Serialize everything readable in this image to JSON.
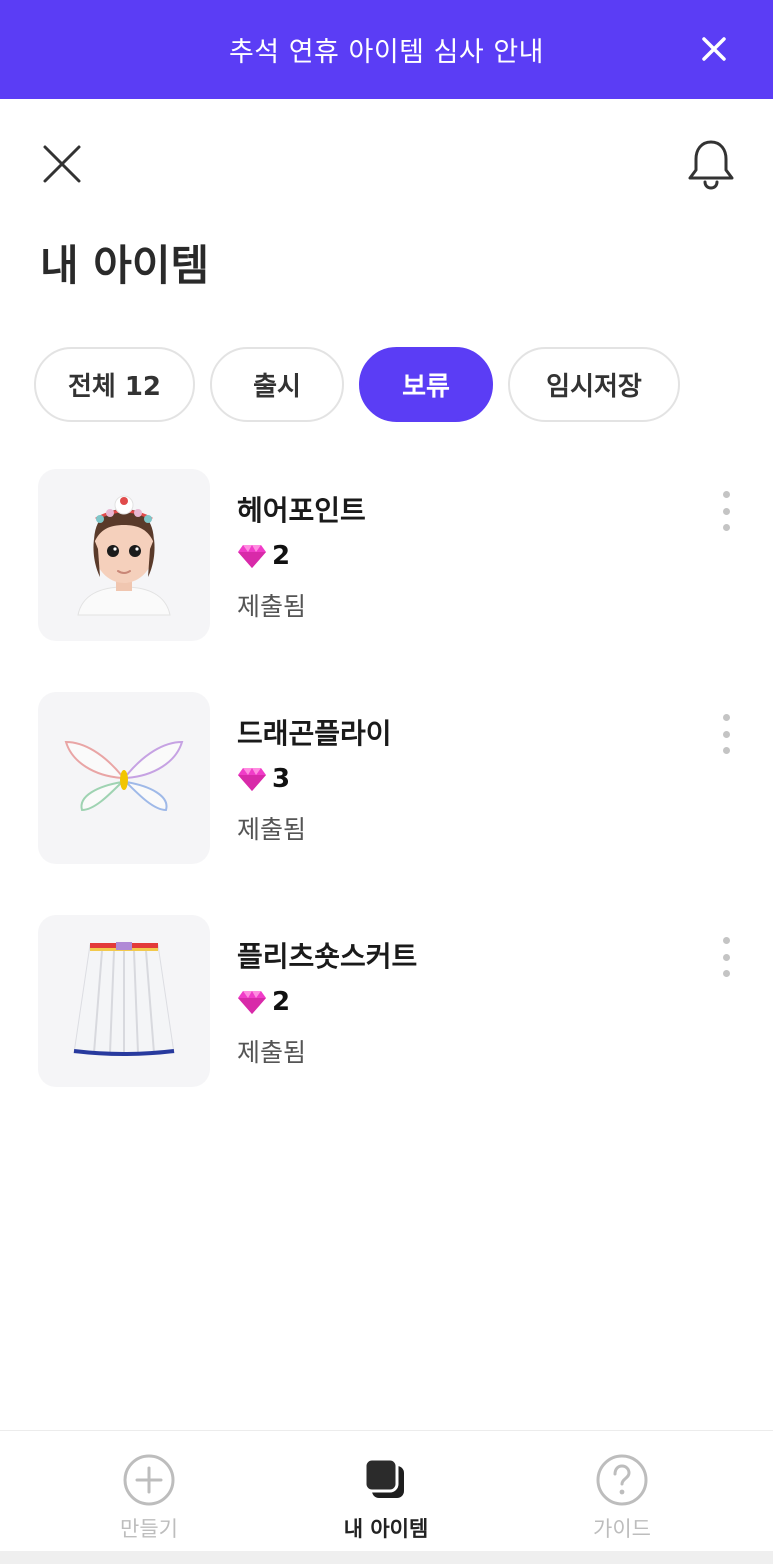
{
  "banner": {
    "text": "추석 연휴 아이템 심사 안내",
    "accent": "#5b3df5"
  },
  "header": {
    "title": "내 아이템"
  },
  "tabs": [
    {
      "label": "전체 12",
      "active": false
    },
    {
      "label": "출시",
      "active": false
    },
    {
      "label": "보류",
      "active": true
    },
    {
      "label": "임시저장",
      "active": false
    }
  ],
  "items": [
    {
      "name": "헤어포인트",
      "price": "2",
      "status": "제출됨",
      "thumb_icon": "avatar-hair-accessory"
    },
    {
      "name": "드래곤플라이",
      "price": "3",
      "status": "제출됨",
      "thumb_icon": "dragonfly-wings"
    },
    {
      "name": "플리츠숏스커트",
      "price": "2",
      "status": "제출됨",
      "thumb_icon": "pleated-skirt"
    }
  ],
  "bottom_nav": {
    "create": "만들기",
    "my_items": "내 아이템",
    "guide": "가이드",
    "active": "my_items"
  },
  "colors": {
    "gem": "#f03cc8",
    "inactive": "#bdbdbd"
  }
}
